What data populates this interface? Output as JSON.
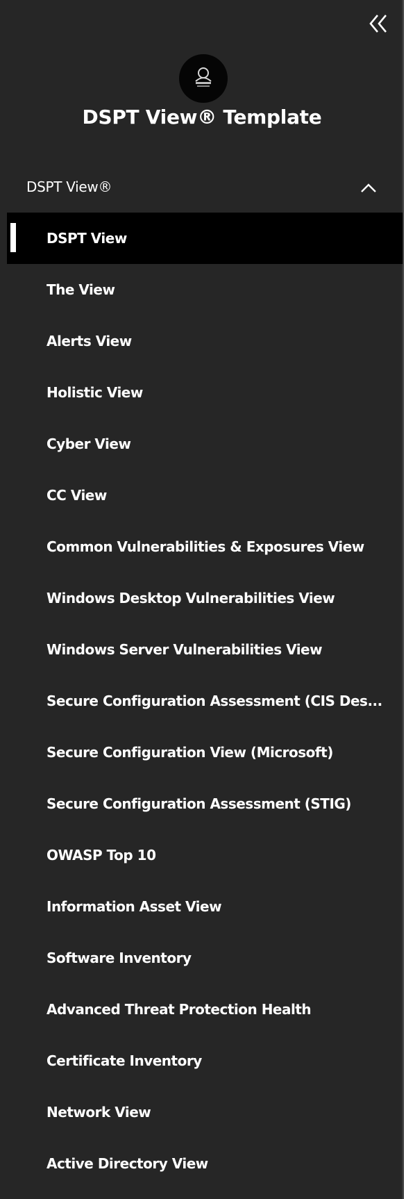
{
  "app": {
    "title": "DSPT View® Template"
  },
  "section": {
    "label": "DSPT View®",
    "expanded": true
  },
  "nav": {
    "active_index": 0,
    "items": [
      {
        "label": "DSPT View"
      },
      {
        "label": "The View"
      },
      {
        "label": "Alerts View"
      },
      {
        "label": "Holistic View"
      },
      {
        "label": "Cyber View"
      },
      {
        "label": "CC View"
      },
      {
        "label": "Common Vulnerabilities & Exposures View"
      },
      {
        "label": "Windows Desktop Vulnerabilities View"
      },
      {
        "label": "Windows Server Vulnerabilities View"
      },
      {
        "label": "Secure Configuration Assessment (CIS Des..."
      },
      {
        "label": "Secure Configuration View (Microsoft)"
      },
      {
        "label": "Secure Configuration Assessment (STIG)"
      },
      {
        "label": "OWASP Top 10"
      },
      {
        "label": "Information Asset View"
      },
      {
        "label": "Software Inventory"
      },
      {
        "label": "Advanced Threat Protection Health"
      },
      {
        "label": "Certificate Inventory"
      },
      {
        "label": "Network View"
      },
      {
        "label": "Active Directory View"
      }
    ]
  },
  "colors": {
    "sidebar_bg": "#262626",
    "active_bg": "#000000",
    "text": "#ffffff"
  },
  "icons": {
    "collapse": "double-chevron-left-icon",
    "section_toggle": "chevron-up-icon",
    "logo": "logo-icon"
  }
}
